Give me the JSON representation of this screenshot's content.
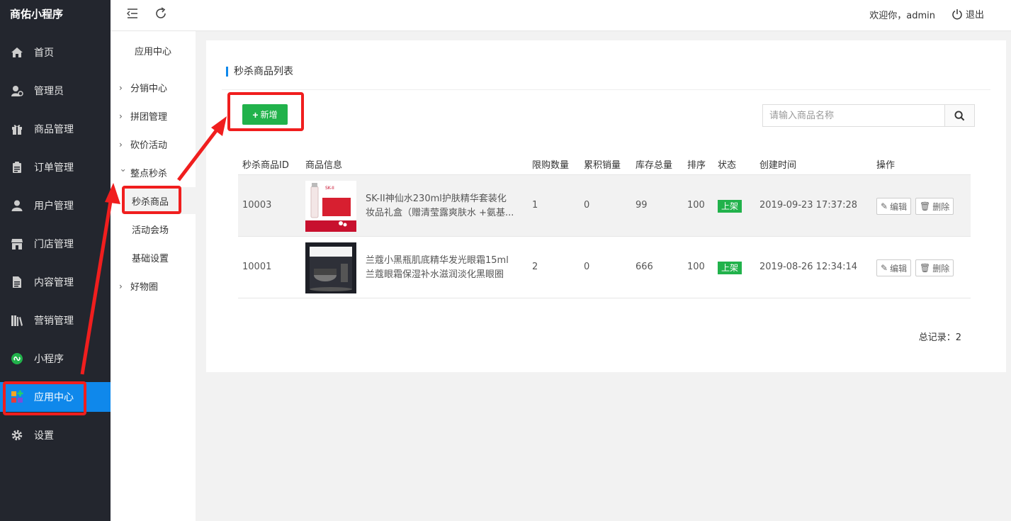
{
  "app": {
    "title": "商佑小程序"
  },
  "sidebar": {
    "items": [
      {
        "label": "首页",
        "icon": "home-icon"
      },
      {
        "label": "管理员",
        "icon": "admin-user-icon"
      },
      {
        "label": "商品管理",
        "icon": "gift-icon"
      },
      {
        "label": "订单管理",
        "icon": "clipboard-icon"
      },
      {
        "label": "用户管理",
        "icon": "user-icon"
      },
      {
        "label": "门店管理",
        "icon": "store-icon"
      },
      {
        "label": "内容管理",
        "icon": "document-icon"
      },
      {
        "label": "营销管理",
        "icon": "books-icon"
      },
      {
        "label": "小程序",
        "icon": "mini-program-icon"
      },
      {
        "label": "应用中心",
        "icon": "app-center-icon",
        "active": true
      },
      {
        "label": "设置",
        "icon": "gear-icon"
      }
    ]
  },
  "submenu": {
    "title": "应用中心",
    "groups": [
      {
        "label": "分销中心",
        "expanded": false
      },
      {
        "label": "拼团管理",
        "expanded": false
      },
      {
        "label": "砍价活动",
        "expanded": false
      },
      {
        "label": "整点秒杀",
        "expanded": true,
        "children": [
          "秒杀商品",
          "活动会场",
          "基础设置"
        ]
      },
      {
        "label": "好物圈",
        "expanded": false
      }
    ]
  },
  "header": {
    "welcome": "欢迎你，admin",
    "logout": "退出"
  },
  "page": {
    "title": "秒杀商品列表",
    "add_label": "新增",
    "search_placeholder": "请输入商品名称"
  },
  "table": {
    "columns": [
      "秒杀商品ID",
      "商品信息",
      "限购数量",
      "累积销量",
      "库存总量",
      "排序",
      "状态",
      "创建时间",
      "操作"
    ],
    "rows": [
      {
        "id": "10003",
        "name": "SK-II神仙水230ml护肤精华套装化妆品礼盒（赠清莹露爽肤水 +氨基...",
        "limit": "1",
        "sales": "0",
        "stock": "99",
        "sort": "100",
        "status": "上架",
        "created": "2019-09-23 17:37:28",
        "edit": "编辑",
        "delete": "删除"
      },
      {
        "id": "10001",
        "name": "兰蔻小黑瓶肌底精华发光眼霜15ml 兰蔻眼霜保湿补水滋润淡化黑眼圈",
        "limit": "2",
        "sales": "0",
        "stock": "666",
        "sort": "100",
        "status": "上架",
        "created": "2019-08-26 12:34:14",
        "edit": "编辑",
        "delete": "删除"
      }
    ]
  },
  "footer": {
    "total": "总记录：2"
  },
  "colors": {
    "primary": "#0f88eb",
    "success": "#21b24b",
    "sidebar": "#23262e",
    "annotation": "#f01e1e"
  }
}
